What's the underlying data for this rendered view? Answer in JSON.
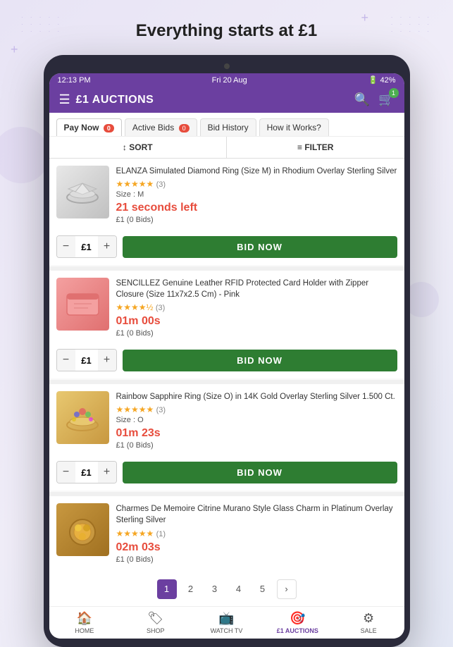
{
  "page": {
    "heading": "Everything starts at £1"
  },
  "statusBar": {
    "time": "12:13 PM",
    "date": "Fri 20 Aug",
    "battery": "42%"
  },
  "header": {
    "title": "£1 AUCTIONS"
  },
  "tabs": [
    {
      "label": "Pay Now",
      "badge": "0",
      "active": true
    },
    {
      "label": "Active Bids",
      "badge": "0",
      "active": false
    },
    {
      "label": "Bid History",
      "badge": null,
      "active": false
    },
    {
      "label": "How it Works?",
      "badge": null,
      "active": false
    }
  ],
  "sortFilterBar": {
    "sort": "↕ SORT",
    "filter": "≡ FILTER"
  },
  "products": [
    {
      "id": 1,
      "title": "ELANZA Simulated Diamond Ring (Size M) in Rhodium Overlay Sterling Silver",
      "size": "Size : M",
      "stars": 5,
      "reviewCount": "(3)",
      "timer": "21",
      "timerUnit": "seconds left",
      "timerFull": "21 seconds left",
      "price": "£1 (0 Bids)",
      "qty": "£1",
      "imgType": "diamond-ring"
    },
    {
      "id": 2,
      "title": "SENCILLEZ Genuine Leather RFID Protected Card Holder with Zipper Closure (Size 11x7x2.5 Cm) - Pink",
      "size": null,
      "stars": 4.5,
      "reviewCount": "(3)",
      "timer": "01m 00s",
      "timerFull": "01m 00s",
      "price": "£1 (0 Bids)",
      "qty": "£1",
      "imgType": "wallet"
    },
    {
      "id": 3,
      "title": "Rainbow Sapphire Ring (Size O) in 14K Gold Overlay Sterling Silver 1.500 Ct.",
      "size": "Size : O",
      "stars": 5,
      "reviewCount": "(3)",
      "timer": "01m 23s",
      "timerFull": "01m 23s",
      "price": "£1 (0 Bids)",
      "qty": "£1",
      "imgType": "sapphire-ring"
    },
    {
      "id": 4,
      "title": "Charmes De Memoire Citrine Murano Style Glass Charm in Platinum Overlay Sterling Silver",
      "size": null,
      "stars": 5,
      "reviewCount": "(1)",
      "timer": "02m 03s",
      "timerFull": "02m 03s",
      "price": "£1 (0 Bids)",
      "qty": "£1",
      "imgType": "citrine-charm"
    }
  ],
  "bidButton": "BID NOW",
  "pagination": {
    "pages": [
      "1",
      "2",
      "3",
      "4",
      "5"
    ],
    "current": "1"
  },
  "bottomNav": [
    {
      "label": "HOME",
      "icon": "🏠",
      "active": false
    },
    {
      "label": "SHOP",
      "icon": "🏷",
      "active": false
    },
    {
      "label": "WATCH TV",
      "icon": "📺",
      "active": false
    },
    {
      "label": "£1 AUCTIONS",
      "icon": "🎯",
      "active": true
    },
    {
      "label": "SALE",
      "icon": "⚙",
      "active": false
    }
  ]
}
